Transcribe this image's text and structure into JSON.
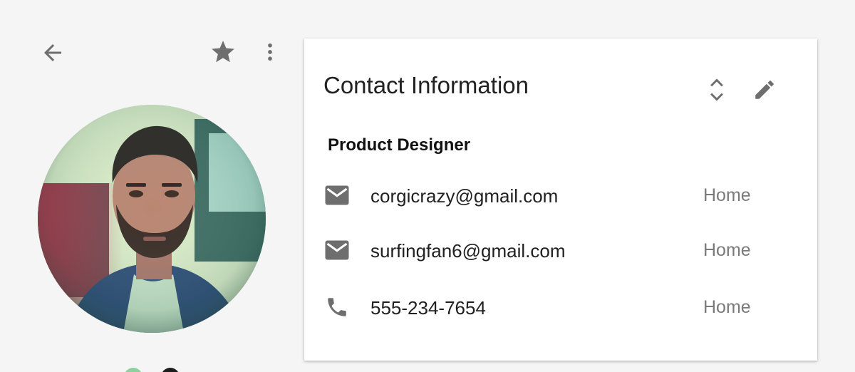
{
  "toolbar": {
    "back_icon": "arrow-back-icon",
    "star_icon": "star-icon",
    "menu_icon": "more-vert-icon"
  },
  "profile": {
    "avatar_alt": "contact-photo"
  },
  "card": {
    "title": "Contact Information",
    "expand_icon": "unfold-more-icon",
    "edit_icon": "edit-pencil-icon",
    "job_title": "Product Designer",
    "entries": [
      {
        "icon": "email-icon",
        "value": "corgicrazy@gmail.com",
        "type": "Home"
      },
      {
        "icon": "email-icon",
        "value": "surfingfan6@gmail.com",
        "type": "Home"
      },
      {
        "icon": "phone-icon",
        "value": "555-234-7654",
        "type": "Home"
      }
    ]
  },
  "colors": {
    "background": "#f5f5f5",
    "card": "#ffffff",
    "icon_gray": "#6e6e6e",
    "text_primary": "#212121",
    "text_secondary": "#7a7a7a",
    "accent_green": "#8fd19e"
  }
}
